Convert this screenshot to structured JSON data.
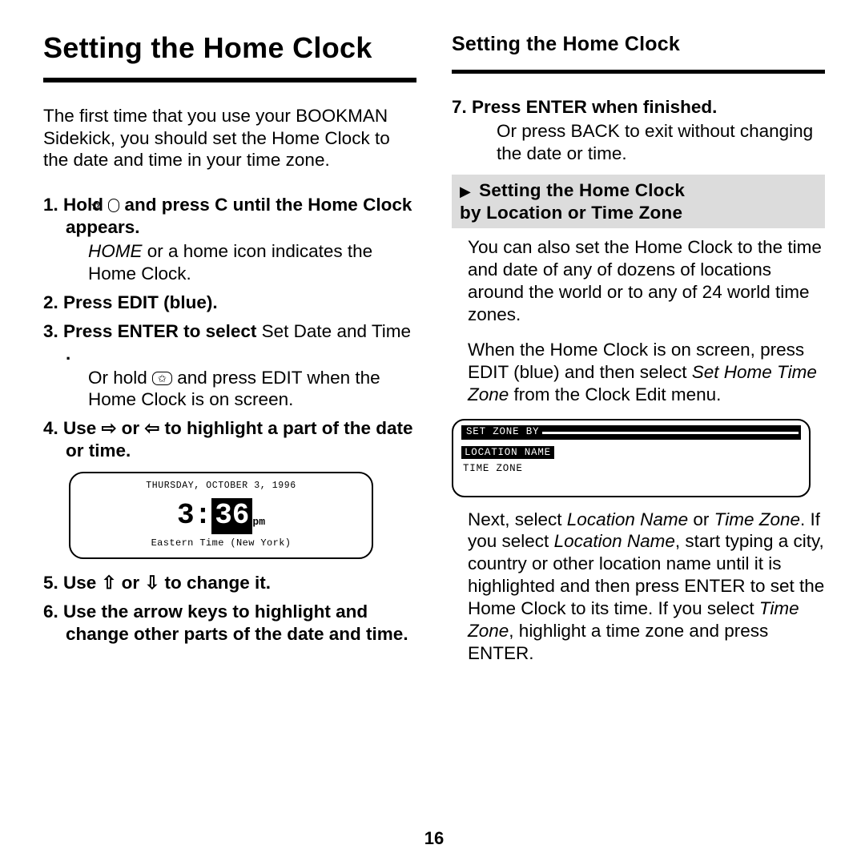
{
  "page_number": "16",
  "left": {
    "title": "Setting the Home Clock",
    "intro": "The first time that you use your BOOKMAN Sidekick, you should set the Home Clock to the date and time in your time zone.",
    "steps": {
      "s1_num": "1.",
      "s1_a": "Hold ",
      "s1_star": "✩",
      "s1_b": " and press C until the Home Clock appears.",
      "s1_body_pre": "HOME",
      "s1_body_post": " or a home icon indicates the Home Clock.",
      "s2_num": "2.",
      "s2": "Press EDIT (blue).",
      "s3_num": "3.",
      "s3_head": "Press ENTER to select ",
      "s3_sel_a": "Set Date and Time",
      "s3_sel_dot": " .",
      "s3_body_a": "Or hold ",
      "s3_star": "✩",
      "s3_body_b": " and press EDIT when the Home Clock is on screen.",
      "s4_num": "4.",
      "s4_a": "Use ",
      "s4_arrow_r": "⇨",
      "s4_mid": " or ",
      "s4_arrow_l": "⇦",
      "s4_b": " to highlight a part of the date or time.",
      "lcd_top": "THURSDAY, OCTOBER 3, 1996",
      "lcd_hour": "3",
      "lcd_min": "36",
      "lcd_ampm": "pm",
      "lcd_bot": "Eastern Time (New York)",
      "s5_num": "5.",
      "s5_a": "Use ",
      "s5_up": "⇧",
      "s5_mid": " or ",
      "s5_dn": "⇩",
      "s5_b": " to change it.",
      "s6_num": "6.",
      "s6": "Use the arrow keys to highlight and change other parts of the date and time."
    }
  },
  "right": {
    "title": "Setting the Home Clock",
    "s7_num": "7.",
    "s7_head": "Press ENTER when finished.",
    "s7_body": "Or press BACK to exit without changing the date or time.",
    "band_tri": "▶",
    "band_l1": "Setting the Home Clock",
    "band_l2": "by Location or Time Zone",
    "p1": "You can also set the Home Clock to the time and date of any of dozens of locations around the world or to any of 24 world time zones.",
    "p2a": "When the Home Clock is on screen, press EDIT (blue) and then select ",
    "p2_i": "Set Home Time Zone",
    "p2b": " from the Clock Edit menu.",
    "lcd_menu": {
      "r1": "SET ZONE BY",
      "r2": "LOCATION NAME",
      "r3": "TIME ZONE"
    },
    "p3a": "Next, select ",
    "p3_i1": "Location Name",
    "p3b": " or ",
    "p3_i2": "Time Zone",
    "p3c": ". If you select ",
    "p3_i3": "Location Name",
    "p3d": ", start typing a city, country or other location name until it is highlighted and then press ENTER to set the Home Clock to its time. If you select ",
    "p3_i4": "Time Zone",
    "p3e": ", highlight a time zone and press ENTER."
  }
}
